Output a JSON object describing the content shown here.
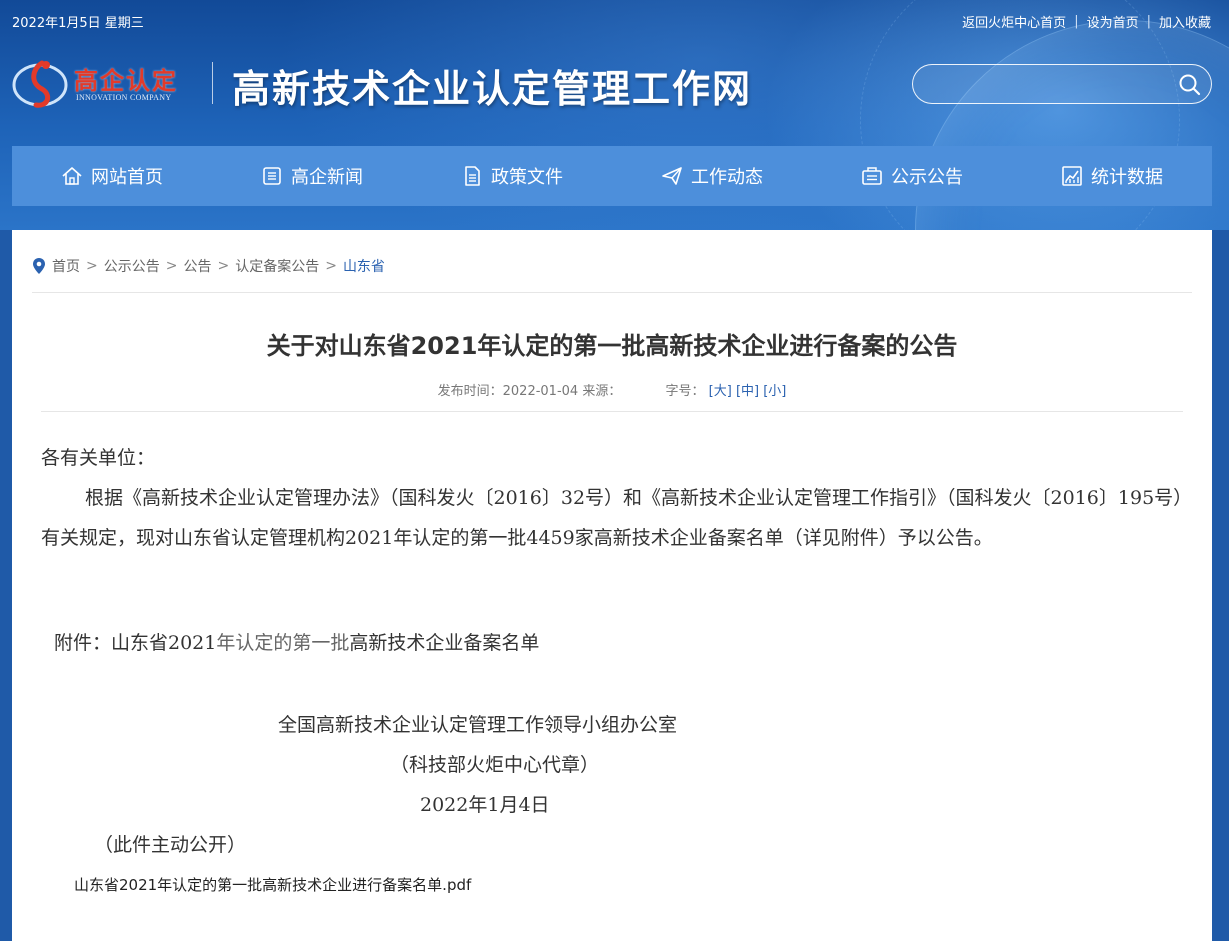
{
  "topbar": {
    "date": "2022年1月5日 星期三",
    "links": [
      "返回火炬中心首页",
      "设为首页",
      "加入收藏"
    ],
    "separator": "|"
  },
  "logo": {
    "cn": "高企认定",
    "en": "INNOVATION COMPANY",
    "accent": "#e23a2a"
  },
  "site_title": "高新技术企业认定管理工作网",
  "search": {
    "placeholder": "",
    "value": "",
    "icon": "search-icon"
  },
  "nav": {
    "items": [
      {
        "label": "网站首页",
        "icon": "home-icon"
      },
      {
        "label": "高企新闻",
        "icon": "news-icon"
      },
      {
        "label": "政策文件",
        "icon": "document-icon"
      },
      {
        "label": "工作动态",
        "icon": "paper-plane-icon"
      },
      {
        "label": "公示公告",
        "icon": "announcement-icon"
      },
      {
        "label": "统计数据",
        "icon": "chart-icon"
      }
    ],
    "bg": "#4d8fdb"
  },
  "breadcrumb": {
    "items": [
      "首页",
      "公示公告",
      "公告",
      "认定备案公告"
    ],
    "current": "山东省",
    "separator": ">"
  },
  "article": {
    "title": "关于对山东省2021年认定的第一批高新技术企业进行备案的公告",
    "meta": {
      "publish_label": "发布时间：",
      "publish_date": "2022-01-04",
      "source_label": "来源：",
      "font_label": "字号：",
      "font_large": "[大]",
      "font_medium": "[中]",
      "font_small": "[小]"
    },
    "greeting": "各有关单位：",
    "paragraph": "根据《高新技术企业认定管理办法》（国科发火〔2016〕32号）和《高新技术企业认定管理工作指引》（国科发火〔2016〕195号）有关规定，现对山东省认定管理机构2021年认定的第一批4459家高新技术企业备案名单（详见附件）予以公告。",
    "attachment_prefix": "附件：山东省2021",
    "attachment_light": "年认定的第一批",
    "attachment_suffix": "高新技术企业备案名单",
    "signature_org": "全国高新技术企业认定管理工作领导小组办公室",
    "signature_seal": "（科技部火炬中心代章）",
    "signature_date": "2022年1月4日",
    "public_note": "（此件主动公开）",
    "file_link": "山东省2021年认定的第一批高新技术企业进行备案名单.pdf"
  }
}
